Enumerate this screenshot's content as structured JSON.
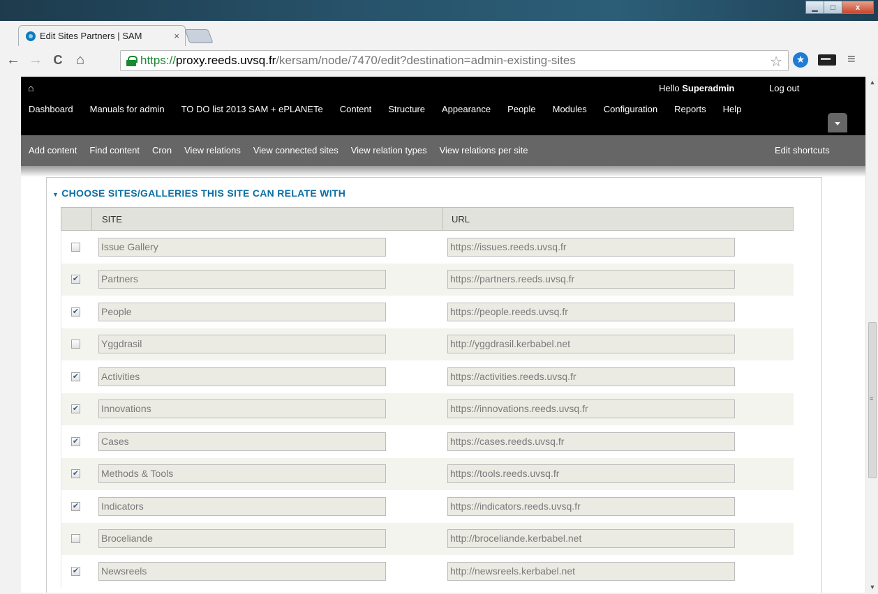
{
  "window": {
    "minimize_glyph": "▁",
    "maximize_glyph": "□",
    "close_glyph": "x"
  },
  "tab": {
    "title": "Edit Sites Partners | SAM",
    "close_glyph": "×"
  },
  "toolbar": {
    "back_glyph": "←",
    "forward_glyph": "→",
    "reload_glyph": "C",
    "home_glyph": "⌂",
    "url_scheme": "https://",
    "url_host": "proxy.reeds.uvsq.fr",
    "url_path": "/kersam/node/7470/edit?destination=admin-existing-sites",
    "star_glyph": "☆",
    "menu_glyph": "≡"
  },
  "admin": {
    "home_glyph": "⌂",
    "greeting_prefix": "Hello ",
    "user_name": "Superadmin",
    "logout": "Log out",
    "menu": [
      "Dashboard",
      "Manuals for admin",
      "TO DO list 2013 SAM + ePLANETe",
      "Content",
      "Structure",
      "Appearance",
      "People",
      "Modules",
      "Configuration",
      "Reports",
      "Help"
    ]
  },
  "shortcuts": {
    "links": [
      "Add content",
      "Find content",
      "Cron",
      "View relations",
      "View connected sites",
      "View relation types",
      "View relations per site"
    ],
    "edit_label": "Edit shortcuts"
  },
  "fieldset": {
    "legend": "CHOOSE SITES/GALLERIES THIS SITE CAN RELATE WITH",
    "columns": [
      "SITE",
      "URL"
    ],
    "rows": [
      {
        "site": "Issue Gallery",
        "url": "https://issues.reeds.uvsq.fr",
        "checked": false
      },
      {
        "site": "Partners",
        "url": "https://partners.reeds.uvsq.fr",
        "checked": true
      },
      {
        "site": "People",
        "url": "https://people.reeds.uvsq.fr",
        "checked": true
      },
      {
        "site": "Yggdrasil",
        "url": "http://yggdrasil.kerbabel.net",
        "checked": false
      },
      {
        "site": "Activities",
        "url": "https://activities.reeds.uvsq.fr",
        "checked": true
      },
      {
        "site": "Innovations",
        "url": "https://innovations.reeds.uvsq.fr",
        "checked": true
      },
      {
        "site": "Cases",
        "url": "https://cases.reeds.uvsq.fr",
        "checked": true
      },
      {
        "site": "Methods & Tools",
        "url": "https://tools.reeds.uvsq.fr",
        "checked": true
      },
      {
        "site": "Indicators",
        "url": "https://indicators.reeds.uvsq.fr",
        "checked": true
      },
      {
        "site": "Broceliande",
        "url": "http://broceliande.kerbabel.net",
        "checked": false
      },
      {
        "site": "Newsreels",
        "url": "http://newsreels.kerbabel.net",
        "checked": true
      }
    ]
  },
  "colors": {
    "legend": "#0b6fa4",
    "admin_bar": "#000000",
    "shortcuts_bar": "#666666",
    "secure_green": "#1a8a2f"
  }
}
